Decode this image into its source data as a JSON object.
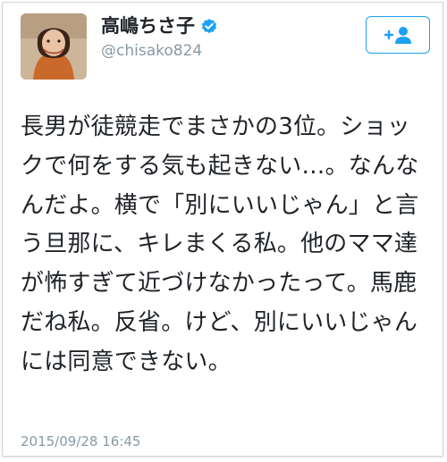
{
  "profile": {
    "display_name": "高嶋ちさ子",
    "handle": "@chisako824",
    "verified_icon": "verified-badge-icon"
  },
  "actions": {
    "follow_icon": "follow-user-icon"
  },
  "tweet": {
    "text": "長男が徒競走でまさかの3位。ショックで何をする気も起きない…。なんなんだよ。横で「別にいいじゃん」と言う旦那に、キレまくる私。他のママ達が怖すぎて近づけなかったって。馬鹿だね私。反省。けど、別にいいじゃんには同意できない。",
    "timestamp": "2015/09/28 16:45"
  },
  "colors": {
    "accent": "#1da1f2",
    "text": "#1f2328",
    "muted": "#8899a6"
  }
}
